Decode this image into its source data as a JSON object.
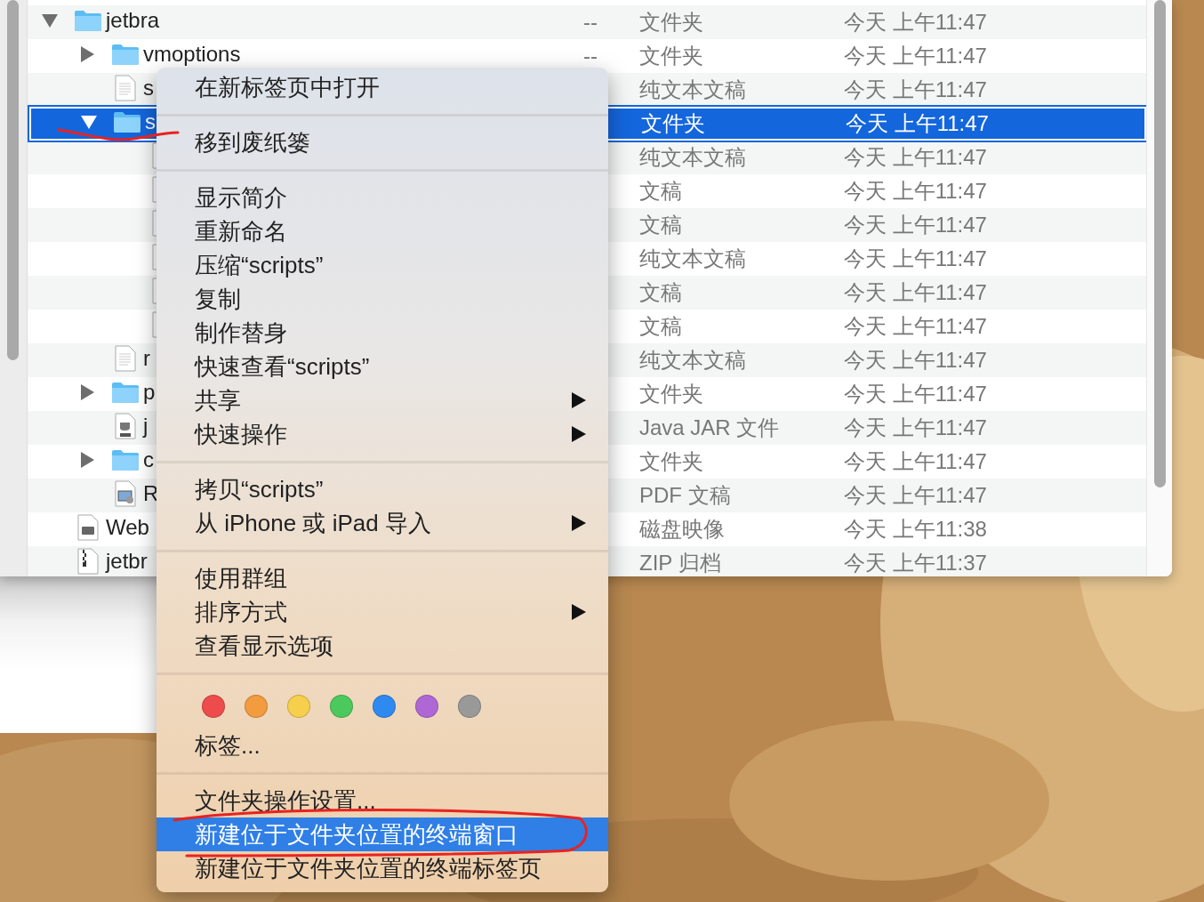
{
  "files": [
    {
      "name": "jetbra",
      "kind": "folder",
      "expanded": true,
      "selected": false,
      "size": "--",
      "type": "文件夹",
      "date": "今天 上午11:47",
      "children": [
        {
          "name": "vmoptions",
          "kind": "folder",
          "expanded": false,
          "selected": false,
          "size": "--",
          "type": "文件夹",
          "date": "今天 上午11:47"
        },
        {
          "name": "s",
          "kind": "text",
          "selected": false,
          "type": "纯文本文稿",
          "date": "今天 上午11:47"
        },
        {
          "name": "s",
          "kind": "folder",
          "expanded": true,
          "selected": true,
          "type": "文件夹",
          "date": "今天 上午11:47",
          "children": [
            {
              "kind": "text",
              "selected": false,
              "type": "纯文本文稿",
              "date": "今天 上午11:47"
            },
            {
              "kind": "text",
              "selected": false,
              "type": "文稿",
              "date": "今天 上午11:47"
            },
            {
              "kind": "text",
              "selected": false,
              "type": "文稿",
              "date": "今天 上午11:47"
            },
            {
              "kind": "text",
              "selected": false,
              "type": "纯文本文稿",
              "date": "今天 上午11:47"
            },
            {
              "kind": "text",
              "selected": false,
              "type": "文稿",
              "date": "今天 上午11:47"
            },
            {
              "kind": "text",
              "selected": false,
              "type": "文稿",
              "date": "今天 上午11:47"
            }
          ]
        },
        {
          "name": "r",
          "kind": "text",
          "selected": false,
          "type": "纯文本文稿",
          "date": "今天 上午11:47"
        },
        {
          "name": "p",
          "kind": "folder",
          "expanded": false,
          "selected": false,
          "type": "文件夹",
          "date": "今天 上午11:47"
        },
        {
          "name": "j",
          "kind": "jar",
          "selected": false,
          "type": "Java JAR 文件",
          "date": "今天 上午11:47"
        },
        {
          "name": "c",
          "kind": "folder",
          "expanded": false,
          "selected": false,
          "type": "文件夹",
          "date": "今天 上午11:47"
        },
        {
          "name": "R",
          "kind": "preview",
          "selected": false,
          "type": "PDF 文稿",
          "date": "今天 上午11:47"
        }
      ]
    },
    {
      "name": "Web",
      "kind": "disk",
      "selected": false,
      "type": "磁盘映像",
      "date": "今天 上午11:38"
    },
    {
      "name": "jetbr",
      "kind": "zip",
      "selected": false,
      "type": "ZIP 归档",
      "date": "今天 上午11:37"
    }
  ],
  "context_menu": {
    "sections": [
      {
        "kind": "items",
        "items": [
          {
            "label": "在新标签页中打开",
            "submenu": false,
            "selected": false
          }
        ]
      },
      {
        "kind": "items",
        "items": [
          {
            "label": "移到废纸篓",
            "submenu": false,
            "selected": false
          }
        ]
      },
      {
        "kind": "items",
        "items": [
          {
            "label": "显示简介",
            "submenu": false,
            "selected": false
          },
          {
            "label": "重新命名",
            "submenu": false,
            "selected": false
          },
          {
            "label": "压缩“scripts”",
            "submenu": false,
            "selected": false
          },
          {
            "label": "复制",
            "submenu": false,
            "selected": false
          },
          {
            "label": "制作替身",
            "submenu": false,
            "selected": false
          },
          {
            "label": "快速查看“scripts”",
            "submenu": false,
            "selected": false
          },
          {
            "label": "共享",
            "submenu": true,
            "selected": false
          },
          {
            "label": "快速操作",
            "submenu": true,
            "selected": false
          }
        ]
      },
      {
        "kind": "items",
        "items": [
          {
            "label": "拷贝“scripts”",
            "submenu": false,
            "selected": false
          },
          {
            "label": "从 iPhone 或 iPad 导入",
            "submenu": true,
            "selected": false
          }
        ]
      },
      {
        "kind": "items",
        "items": [
          {
            "label": "使用群组",
            "submenu": false,
            "selected": false
          },
          {
            "label": "排序方式",
            "submenu": true,
            "selected": false
          },
          {
            "label": "查看显示选项",
            "submenu": false,
            "selected": false
          }
        ]
      },
      {
        "kind": "tags",
        "tags": [
          {
            "color": "#ee4c4c"
          },
          {
            "color": "#f29b3f"
          },
          {
            "color": "#f6cf4c"
          },
          {
            "color": "#4cc95c"
          },
          {
            "color": "#2f8af0"
          },
          {
            "color": "#b067d6"
          },
          {
            "color": "#999999"
          }
        ],
        "label": "标签..."
      },
      {
        "kind": "items",
        "items": [
          {
            "label": "文件夹操作设置...",
            "submenu": false,
            "selected": false
          },
          {
            "label": "新建位于文件夹位置的终端窗口",
            "submenu": false,
            "selected": true
          },
          {
            "label": "新建位于文件夹位置的终端标签页",
            "submenu": false,
            "selected": false
          }
        ]
      }
    ]
  }
}
